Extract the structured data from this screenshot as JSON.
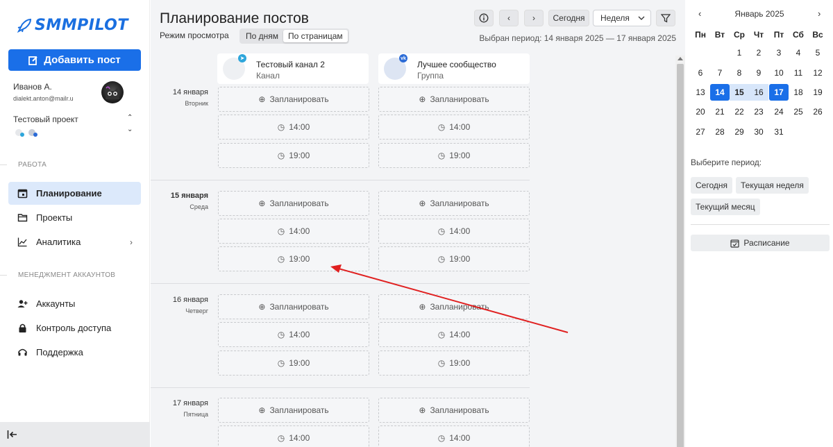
{
  "sidebar": {
    "logo": "SMMPILOT",
    "add_post": "Добавить пост",
    "user": {
      "name": "Иванов А.",
      "email": "dialekt.anton@mailr.u"
    },
    "project": {
      "name": "Тестовый проект"
    },
    "sections": {
      "work": "РАБОТА",
      "accounts_mgmt": "МЕНЕДЖМЕНТ АККАУНТОВ"
    },
    "nav": {
      "planning": "Планирование",
      "projects": "Проекты",
      "analytics": "Аналитика",
      "accounts": "Аккаунты",
      "access": "Контроль доступа",
      "support": "Поддержка"
    }
  },
  "header": {
    "title": "Планирование постов",
    "mode_label": "Режим просмотра",
    "mode_by_days": "По дням",
    "mode_by_pages": "По страницам",
    "today": "Сегодня",
    "period_select": "Неделя",
    "period_text": "Выбран период: 14 января 2025 — 17 января 2025"
  },
  "channels": [
    {
      "name": "Тестовый канал 2",
      "type": "Канал",
      "network": "telegram"
    },
    {
      "name": "Лучшее сообщество",
      "type": "Группа",
      "network": "vk"
    }
  ],
  "slot_labels": {
    "plan": "Запланировать",
    "t1": "14:00",
    "t2": "19:00"
  },
  "days": [
    {
      "date": "14 января",
      "weekday": "Вторник"
    },
    {
      "date": "15 января",
      "weekday": "Среда"
    },
    {
      "date": "16 января",
      "weekday": "Четверг"
    },
    {
      "date": "17 января",
      "weekday": "Пятница"
    }
  ],
  "calendar": {
    "month": "Январь 2025",
    "weekdays": [
      "Пн",
      "Вт",
      "Ср",
      "Чт",
      "Пт",
      "Сб",
      "Вс"
    ],
    "weeks": [
      [
        "",
        "",
        "1",
        "2",
        "3",
        "4",
        "5"
      ],
      [
        "6",
        "7",
        "8",
        "9",
        "10",
        "11",
        "12"
      ],
      [
        "13",
        "14",
        "15",
        "16",
        "17",
        "18",
        "19"
      ],
      [
        "20",
        "21",
        "22",
        "23",
        "24",
        "25",
        "26"
      ],
      [
        "27",
        "28",
        "29",
        "30",
        "31",
        "",
        ""
      ]
    ],
    "selected": [
      "14",
      "17"
    ],
    "range": [
      "15",
      "16"
    ],
    "period_label": "Выберите период:",
    "chips": {
      "today": "Сегодня",
      "week": "Текущая неделя",
      "month": "Текущий месяц"
    },
    "schedule": "Расписание"
  },
  "colors": {
    "accent": "#1a6fe8",
    "active_nav": "#dce9fb",
    "arrow": "#e02020"
  }
}
